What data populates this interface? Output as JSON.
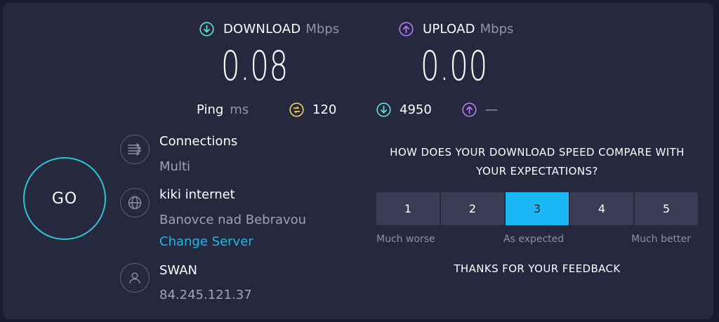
{
  "download": {
    "label": "DOWNLOAD",
    "unit": "Mbps",
    "value": "0.08",
    "icon": "download-arrow-icon",
    "color": "#5ee3d6"
  },
  "upload": {
    "label": "UPLOAD",
    "unit": "Mbps",
    "value": "0.00",
    "icon": "upload-arrow-icon",
    "color": "#b57bf5"
  },
  "ping": {
    "label": "Ping",
    "unit": "ms",
    "idle": {
      "value": "120",
      "icon": "idle-latency-icon",
      "color": "#f1d25c"
    },
    "download": {
      "value": "4950",
      "icon": "download-latency-icon",
      "color": "#5ee3d6"
    },
    "upload": {
      "value": "—",
      "icon": "upload-latency-icon",
      "color": "#b57bf5"
    }
  },
  "go_button": {
    "label": "GO",
    "color": "#2ec3d8"
  },
  "connections": {
    "title": "Connections",
    "value": "Multi",
    "icon": "connections-icon"
  },
  "server": {
    "title": "kiki internet",
    "location": "Banovce nad Bebravou",
    "change_label": "Change Server",
    "icon": "globe-icon"
  },
  "provider": {
    "title": "SWAN",
    "ip": "84.245.121.37",
    "icon": "user-icon"
  },
  "survey": {
    "question": "HOW DOES YOUR DOWNLOAD SPEED COMPARE WITH YOUR EXPECTATIONS?",
    "options": [
      "1",
      "2",
      "3",
      "4",
      "5"
    ],
    "selected": "3",
    "labels": {
      "low": "Much worse",
      "mid": "As expected",
      "high": "Much better"
    },
    "thanks": "THANKS FOR YOUR FEEDBACK"
  }
}
